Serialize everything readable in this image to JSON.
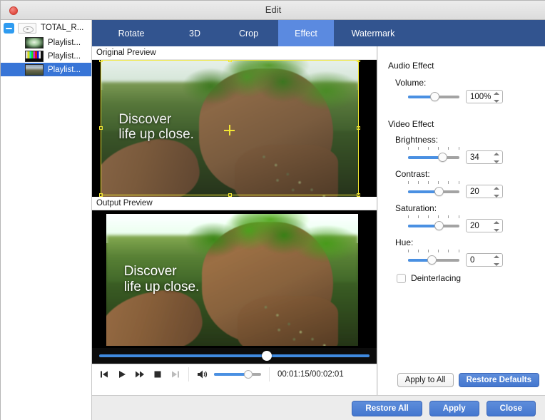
{
  "window": {
    "title": "Edit",
    "close_icon": "close-icon"
  },
  "sidebar": {
    "root": {
      "label": "TOTAL_R...",
      "disclosure_icon": "collapse-minus-icon",
      "visibility_icon": "eye-icon"
    },
    "items": [
      {
        "label": "Playlist...",
        "thumb": "blurred-light-thumbnail",
        "selected": false
      },
      {
        "label": "Playlist...",
        "thumb": "color-bars-thumbnail",
        "selected": false
      },
      {
        "label": "Playlist...",
        "thumb": "landscape-thumbnail",
        "selected": true
      }
    ]
  },
  "tabs": [
    {
      "label": "Rotate",
      "active": false
    },
    {
      "label": "3D",
      "active": false
    },
    {
      "label": "Crop",
      "active": false
    },
    {
      "label": "Effect",
      "active": true
    },
    {
      "label": "Watermark",
      "active": false
    }
  ],
  "preview": {
    "original_label": "Original Preview",
    "output_label": "Output Preview",
    "overlay_text": "Discover\nlife up close.",
    "crop_crosshair_icon": "crop-crosshair-icon"
  },
  "player": {
    "seek_percent": 62,
    "buttons": [
      {
        "name": "previous-button",
        "icon": "skip-previous-icon",
        "enabled": true
      },
      {
        "name": "play-button",
        "icon": "play-icon",
        "enabled": true
      },
      {
        "name": "fast-forward-button",
        "icon": "fast-forward-icon",
        "enabled": true
      },
      {
        "name": "stop-button",
        "icon": "stop-icon",
        "enabled": true
      },
      {
        "name": "next-button",
        "icon": "skip-next-icon",
        "enabled": false
      }
    ],
    "volume_icon": "speaker-icon",
    "volume_percent": 72,
    "timecode": "00:01:15/00:02:01"
  },
  "effects": {
    "audio_section": "Audio Effect",
    "video_section": "Video Effect",
    "volume": {
      "label": "Volume:",
      "value": "100%",
      "slider_percent": 52
    },
    "brightness": {
      "label": "Brightness:",
      "value": "34",
      "slider_percent": 67
    },
    "contrast": {
      "label": "Contrast:",
      "value": "20",
      "slider_percent": 60
    },
    "saturation": {
      "label": "Saturation:",
      "value": "20",
      "slider_percent": 60
    },
    "hue": {
      "label": "Hue:",
      "value": "0",
      "slider_percent": 46
    },
    "deinterlacing": {
      "label": "Deinterlacing",
      "checked": false
    }
  },
  "panel_buttons": {
    "apply_to_all": "Apply to All",
    "restore_defaults": "Restore Defaults"
  },
  "footer_buttons": {
    "restore_all": "Restore All",
    "apply": "Apply",
    "close": "Close"
  },
  "colors": {
    "tabbar": "#32548f",
    "tab_active": "#5b8ae0",
    "accent_blue": "#4a90e2",
    "selection_blue": "#3875d7",
    "primary_button": "#4477cf",
    "crop_yellow": "#f2e733"
  }
}
